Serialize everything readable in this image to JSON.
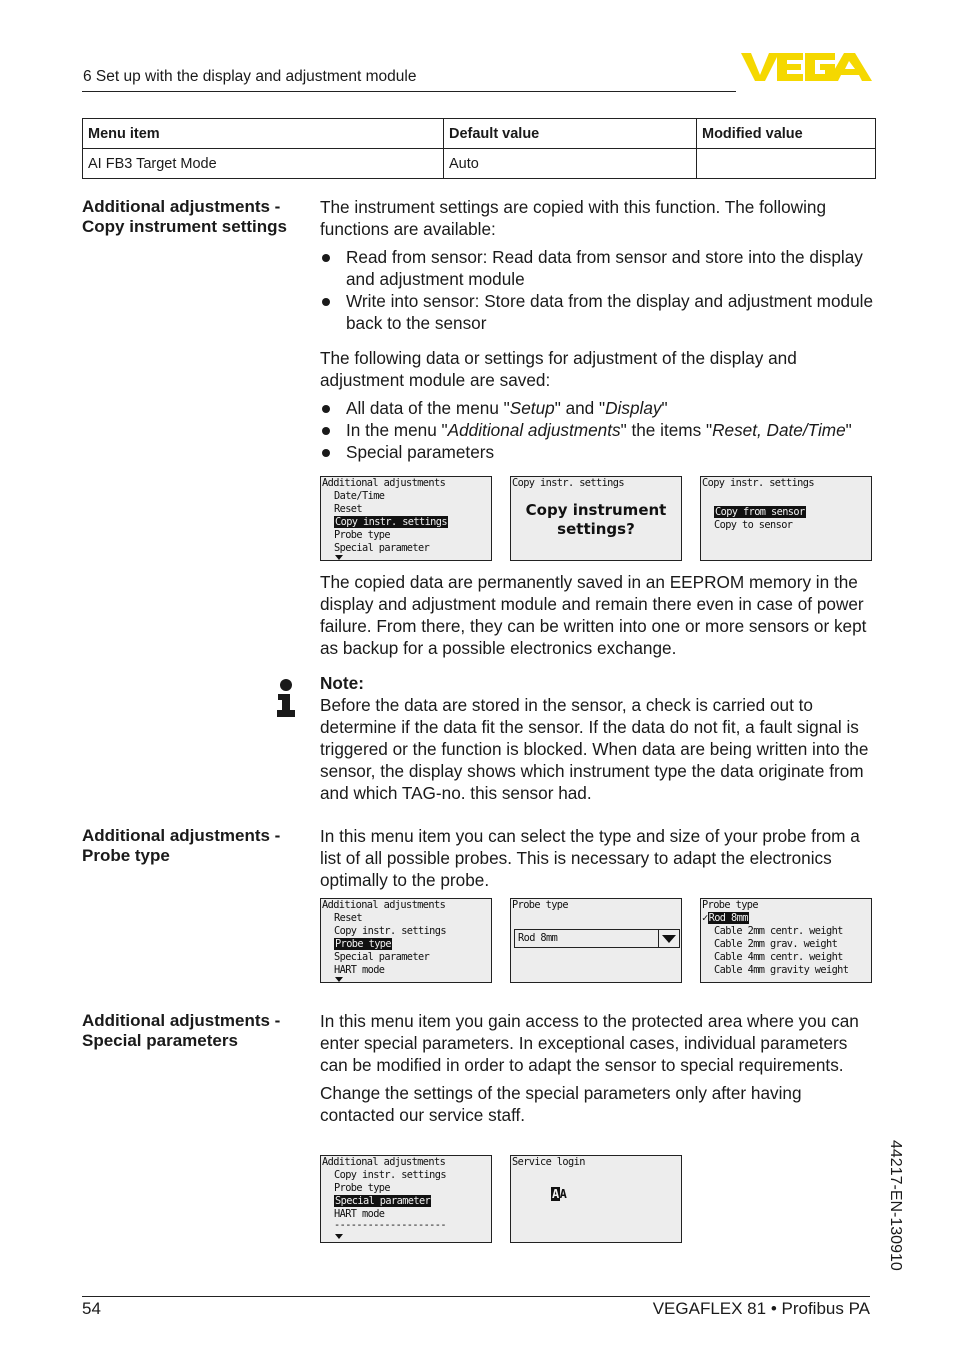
{
  "header": {
    "section_title": "6 Set up with the display and adjustment module",
    "logo_text": "VEGA",
    "logo_color": "#f5d800"
  },
  "settings_table": {
    "columns": [
      "Menu item",
      "Default value",
      "Modified value"
    ],
    "rows": [
      [
        "AI FB3 Target Mode",
        "Auto",
        ""
      ]
    ]
  },
  "sections": {
    "copy": {
      "heading_line1": "Additional adjustments -",
      "heading_line2": "Copy instrument settings",
      "intro": "The instrument settings are copied with this function. The following functions are available:",
      "functions": [
        "Read from sensor: Read data from sensor and store into the display and adjustment module",
        "Write into sensor: Store data from the display and adjustment module back to the sensor"
      ],
      "saved_intro": "The following data or settings for adjustment of the display and adjustment module are saved:",
      "saved_items": {
        "item1_a": "All data of the menu \"",
        "item1_setup": "Setup",
        "item1_b": "\" and \"",
        "item1_display": "Display",
        "item1_c": "\"",
        "item2_a": "In the menu \"",
        "item2_menu": "Additional adjustments",
        "item2_b": "\" the items \"",
        "item2_items": "Reset, Date/Time",
        "item2_c": "\"",
        "item3": "Special parameters"
      },
      "screens": {
        "s1": {
          "title": "Additional adjustments",
          "items": [
            "Date/Time",
            "Reset",
            "Copy instr. settings",
            "Probe type",
            "Special parameter"
          ],
          "selected_index": 2
        },
        "s2": {
          "title": "Copy instr. settings",
          "question_line1": "Copy instrument",
          "question_line2": "settings?"
        },
        "s3": {
          "title": "Copy instr. settings",
          "options": [
            "Copy from sensor",
            "Copy to sensor"
          ],
          "selected_index": 0
        }
      },
      "eeprom_text": "The copied data are permanently saved in an EEPROM memory in the display and adjustment module and remain there even in case of power failure. From there, they can be written into one or more sensors or kept as backup for a possible electronics exchange.",
      "note_label": "Note:",
      "note_text": "Before the data are stored in the sensor, a check is carried out to determine if the data fit the sensor. If the data do not fit, a fault signal is triggered or the function is blocked. When data are being written into the sensor, the display shows which instrument type the data originate from and which TAG-no. this sensor had."
    },
    "probe": {
      "heading_line1": "Additional adjustments -",
      "heading_line2": "Probe type",
      "text": "In this menu item you can select the type and size of your probe from a list of all possible probes. This is necessary to adapt the electronics optimally to the probe.",
      "screens": {
        "s1": {
          "title": "Additional adjustments",
          "items": [
            "Reset",
            "Copy instr. settings",
            "Probe type",
            "Special parameter",
            "HART mode"
          ],
          "selected_index": 2
        },
        "s2": {
          "title": "Probe type",
          "combo_value": "Rod 8mm"
        },
        "s3": {
          "title": "Probe type",
          "checkmark": "✓",
          "options": [
            "Rod 8mm",
            "Cable 2mm centr. weight",
            "Cable 2mm grav. weight",
            "Cable 4mm centr. weight",
            "Cable 4mm gravity weight"
          ],
          "selected_index": 0
        }
      }
    },
    "special": {
      "heading_line1": "Additional adjustments -",
      "heading_line2": "Special parameters",
      "text1": "In this menu item you gain access to the protected area where you can enter special parameters. In exceptional cases, individual parameters can be modified in order to adapt the sensor to special requirements.",
      "text2": "Change the settings of the special parameters only after having contacted our service staff.",
      "screens": {
        "s1": {
          "title": "Additional adjustments",
          "items": [
            "Copy instr. settings",
            "Probe type",
            "Special parameter",
            "HART mode"
          ],
          "separator": "--------------------",
          "selected_index": 2
        },
        "s2": {
          "title": "Service login",
          "input_cursor_char": "A",
          "input_char": "A"
        }
      }
    }
  },
  "footer": {
    "page_number": "54",
    "product": "VEGAFLEX 81 • Profibus PA",
    "doc_code": "44217-EN-130910"
  }
}
